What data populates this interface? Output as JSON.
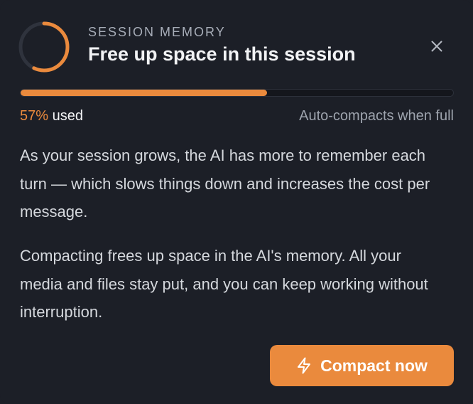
{
  "header": {
    "eyebrow": "SESSION MEMORY",
    "title": "Free up space in this session",
    "close_icon": "close-icon"
  },
  "usage": {
    "fraction": 0.57,
    "percent_label": "57%",
    "used_suffix": " used",
    "auto_note": "Auto-compacts when full"
  },
  "body": {
    "paragraph_1": "As your session grows, the AI has more to remember each turn — which slows things down and increases the cost per message.",
    "paragraph_2": "Compacting frees up space in the AI's memory. All your media and files stay put, and you can keep working without interruption."
  },
  "action": {
    "icon": "lightning-bolt-icon",
    "label": "Compact now"
  },
  "colors": {
    "accent": "#ea8a3d",
    "background": "#1c1f27",
    "track": "#14161c",
    "ring_track": "#2f333d"
  }
}
